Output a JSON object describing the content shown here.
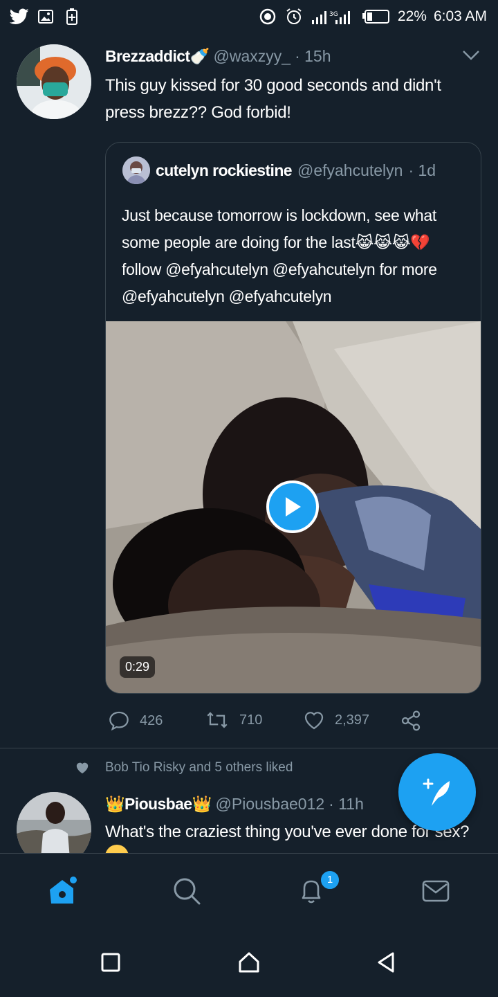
{
  "status_bar": {
    "battery": "22%",
    "time": "6:03 AM",
    "network": "3G"
  },
  "tweet1": {
    "name": "Brezzaddict🍼",
    "handle": "@waxzyy_",
    "time": "· 15h",
    "text": "This guy kissed for 30 good seconds and didn't press brezz?? God forbid!",
    "quoted": {
      "name": "cutelyn rockiestine",
      "handle": "@efyahcutelyn",
      "time": "· 1d",
      "text": "Just because tomorrow is lockdown, see what some people are doing for the last😹😹😹💔 follow @efyahcutelyn @efyahcutelyn for more @efyahcutelyn @efyahcutelyn",
      "video_duration": "0:29"
    },
    "replies": "426",
    "retweets": "710",
    "likes": "2,397"
  },
  "tweet2": {
    "social_context": "Bob Tio Risky and 5 others liked",
    "name": "👑Piousbae👑",
    "handle": "@Piousbae012",
    "time": "· 11h",
    "text": "What's the craziest thing you've ever done for sex?"
  },
  "tabs": {
    "notifications_badge": "1"
  },
  "colors": {
    "background": "#15202b",
    "accent": "#1da1f2",
    "secondary_text": "#8899a6",
    "divider": "#38444d"
  }
}
